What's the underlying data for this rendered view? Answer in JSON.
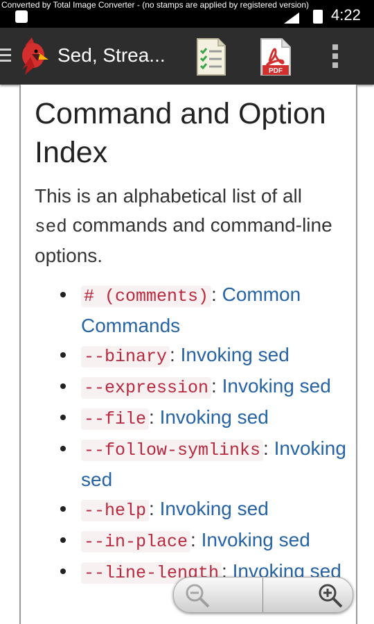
{
  "status_bar": {
    "watermark": "Converted by Total Image Converter - (no stamps are applied by registered version)",
    "time": "4:22"
  },
  "app_bar": {
    "title": "Sed, Strea...",
    "actions": [
      "menu-icon",
      "app-logo",
      "table-of-contents-icon",
      "pdf-icon",
      "overflow-menu-icon"
    ],
    "pdf_badge": "PDF"
  },
  "page": {
    "heading": "Command and Option Index",
    "intro_before": "This is an alphabetical list of all ",
    "intro_code": "sed",
    "intro_after": " commands and command-line options.",
    "entries": [
      {
        "code": "# (comments)",
        "link": "Common Commands"
      },
      {
        "code": "--binary",
        "link": "Invoking sed"
      },
      {
        "code": "--expression",
        "link": "Invoking sed"
      },
      {
        "code": "--file",
        "link": "Invoking sed"
      },
      {
        "code": "--follow-symlinks",
        "link": "Invoking sed"
      },
      {
        "code": "--help",
        "link": "Invoking sed"
      },
      {
        "code": "--in-place",
        "link": "Invoking sed"
      },
      {
        "code": "--line-length",
        "link": "Invoking sed"
      }
    ],
    "separator": ": "
  },
  "zoom_controls": {
    "icons": [
      "zoom-out-icon",
      "zoom-in-icon"
    ],
    "zoom_out_enabled": false
  },
  "colors": {
    "app_bar": "#2d2d2d",
    "link": "#2563a6",
    "code_text": "#b8283e",
    "code_bg": "#f7f1f1"
  }
}
